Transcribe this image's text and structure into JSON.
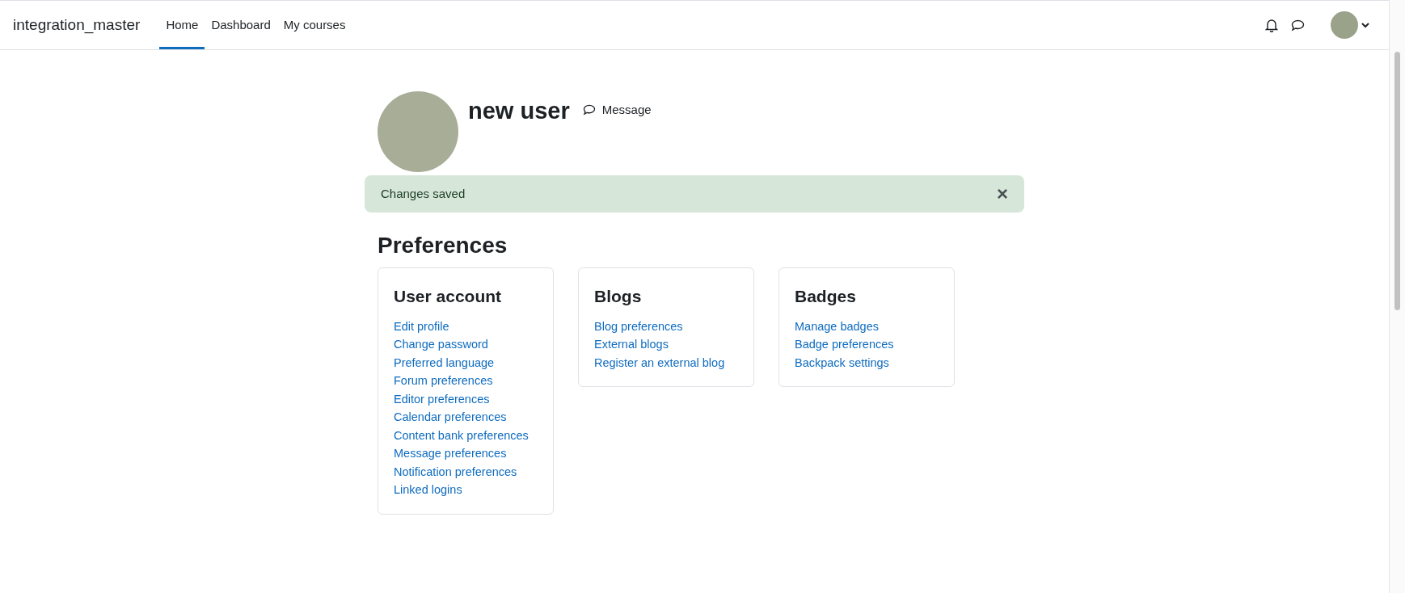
{
  "navbar": {
    "site_name": "integration_master",
    "links": [
      {
        "label": "Home",
        "selected": true
      },
      {
        "label": "Dashboard",
        "selected": false
      },
      {
        "label": "My courses",
        "selected": false
      }
    ]
  },
  "profile": {
    "name": "new user",
    "message_link": "Message"
  },
  "alert": {
    "text": "Changes saved",
    "close": "×"
  },
  "heading": "Preferences",
  "cards": [
    {
      "title": "User account",
      "links": [
        "Edit profile",
        "Change password",
        "Preferred language",
        "Forum preferences",
        "Editor preferences",
        "Calendar preferences",
        "Content bank preferences",
        "Message preferences",
        "Notification preferences",
        "Linked logins"
      ]
    },
    {
      "title": "Blogs",
      "links": [
        "Blog preferences",
        "External blogs",
        "Register an external blog"
      ]
    },
    {
      "title": "Badges",
      "links": [
        "Manage badges",
        "Badge preferences",
        "Backpack settings"
      ]
    }
  ]
}
